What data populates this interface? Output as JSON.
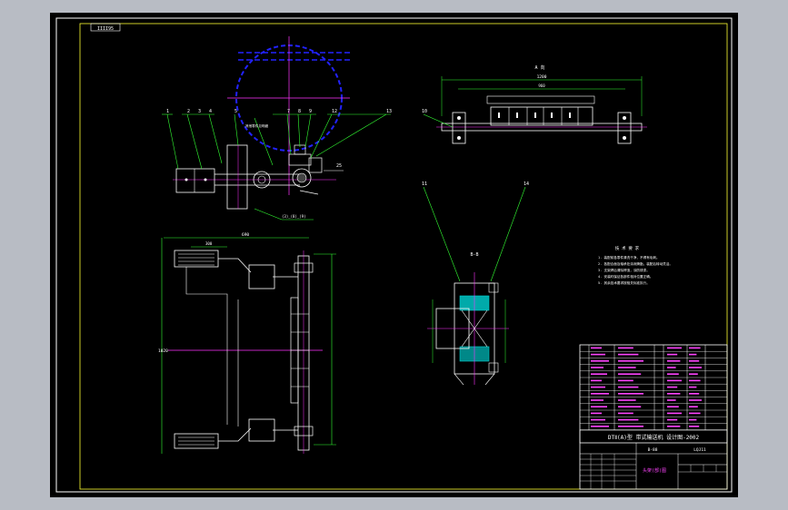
{
  "drawing": {
    "frame_code": "IIII95",
    "title_main": "DTⅡ(A)型 带式输送机 设计图-2002",
    "subtitle_code": "B-88",
    "subtitle_code2": "LQJ11",
    "drawing_name": "头架(部)图",
    "note_title": "技 术 要 求",
    "notes": [
      "1. 装配前各零件清洗干净，不得有毛刺。",
      "2. 各配合面及轴承处涂润滑脂，装配后转动灵活。",
      "3. 支架焊后清除焊渣，涂防锈漆。",
      "4. 安装时保证各部件相对位置正确。",
      "5. 其余技术要求按相关标准执行。"
    ],
    "section_label": "B-B",
    "top_view_label": "A 向"
  },
  "balloons": {
    "b1": "1",
    "b2": "2",
    "b3": "3",
    "b4": "4",
    "b5": "5",
    "b7": "7",
    "b8": "8",
    "b9": "9",
    "b10": "10",
    "b11": "11",
    "b12": "12",
    "b13": "13",
    "b14": "14",
    "b15": "15",
    "ref": "其他零件见明细",
    "ref2": "(3)_(8)_(9)"
  },
  "dims": {
    "top_overall": "1200",
    "top_inner": "960",
    "front_width": "690",
    "front_height": "1020",
    "small_a": "25",
    "small_b": "300"
  },
  "colors": {
    "bg": "#000000",
    "frame": "#ffffff",
    "outline": "#ffffff",
    "centerline": "#ff33ff",
    "dim": "#33ff33",
    "pulley": "#2222ff",
    "hatch": "#00cccc",
    "table": "#ffffff",
    "table_text": "#ff44ff",
    "yellow": "#ffff33"
  }
}
